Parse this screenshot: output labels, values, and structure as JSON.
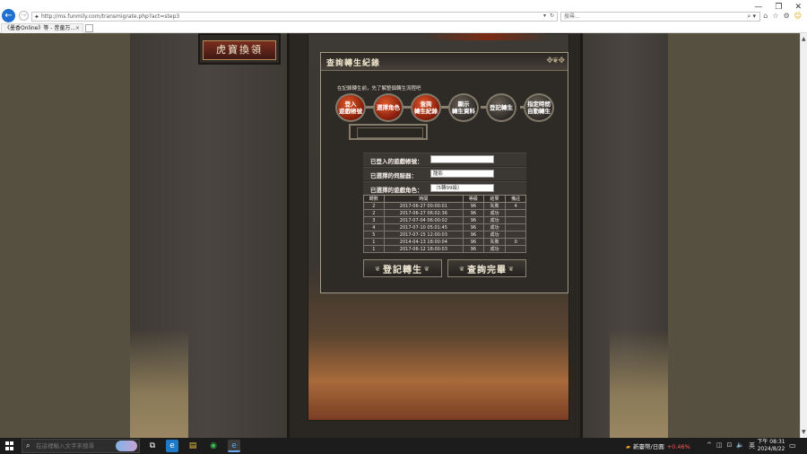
{
  "browser": {
    "url": "http://ms.funmily.com/transmigrate.php?act=step3",
    "search_placeholder": "搜尋...",
    "tab_title": "《墨香Online》等 - 昔童万…",
    "tab_close": "×",
    "back_glyph": "←",
    "forward_glyph": "→",
    "search_glyph": "⌕",
    "addr_dropdown": "▾",
    "addr_refresh": "↻",
    "search_dropdown": "▾",
    "tool_home": "⌂",
    "tool_star": "☆",
    "tool_gear": "⚙",
    "tool_smile": "☺",
    "win_min": "—",
    "win_restore": "❐",
    "win_close": "✕"
  },
  "sidebar": {
    "exchange_label": "虎寶換領"
  },
  "panel": {
    "title": "查詢轉生紀錄",
    "ornament": "✥❦✥",
    "hint": "在記錄轉生前，先了解整個轉生流程吧",
    "steps": [
      {
        "label": "登入\n遊戲帳號",
        "state": "active"
      },
      {
        "label": "選擇角色",
        "state": "active"
      },
      {
        "label": "查詢\n轉生紀錄",
        "state": "active"
      },
      {
        "label": "顯示\n轉生資料",
        "state": "idle"
      },
      {
        "label": "登記轉生",
        "state": "idle"
      },
      {
        "label": "指定時間\n自動轉生",
        "state": "idle"
      }
    ],
    "fields": {
      "account_label": "已登入的遊戲帳號：",
      "account_value": "",
      "server_label": "已選擇的伺服器：",
      "server_value": "龍影",
      "character_label": "已選擇的遊戲角色：",
      "character_value": "（5轉99級）"
    },
    "table": {
      "headers": [
        "轉數",
        "時間",
        "等級",
        "結果",
        "備註"
      ],
      "rows": [
        [
          "2",
          "2017-06-27 00:00:01",
          "96",
          "失敗",
          "4"
        ],
        [
          "2",
          "2017-06-27 06:02:36",
          "96",
          "成功",
          ""
        ],
        [
          "3",
          "2017-07-04 06:00:02",
          "96",
          "成功",
          ""
        ],
        [
          "4",
          "2017-07-10 05:01:45",
          "96",
          "成功",
          ""
        ],
        [
          "5",
          "2017-07-15 12:00:03",
          "96",
          "成功",
          ""
        ],
        [
          "1",
          "2014-04-13 18:00:04",
          "96",
          "失敗",
          "0"
        ],
        [
          "1",
          "2017-06-12 18:00:03",
          "96",
          "成功",
          ""
        ]
      ]
    },
    "register_label": "登記轉生",
    "finish_label": "查詢完畢",
    "button_ornament": "❦"
  },
  "scrollbar": {
    "up_glyph": "▲",
    "down_glyph": "▼"
  },
  "taskbar": {
    "search_placeholder": "在這裡輸入文字來搜尋",
    "search_glyph": "⌕",
    "app_taskview": "⧉",
    "app_edge": "e",
    "app_explorer": "▤",
    "app_chrome": "◉",
    "app_ie": "e",
    "stock_icon": "▰",
    "stock_label": "新臺幣/日圓",
    "stock_change": "+0.46%",
    "tray_chevron": "^",
    "tray_camera": "◫",
    "tray_network": "⊡",
    "tray_volume": "🔈",
    "ime": "英",
    "time": "下午 08:31",
    "date": "2024/8/22",
    "notification_glyph": "▭"
  },
  "colors": {
    "active_step": "#b8321a",
    "browser_accent": "#1f6fd1",
    "stock_change": "#ff5a5a"
  }
}
